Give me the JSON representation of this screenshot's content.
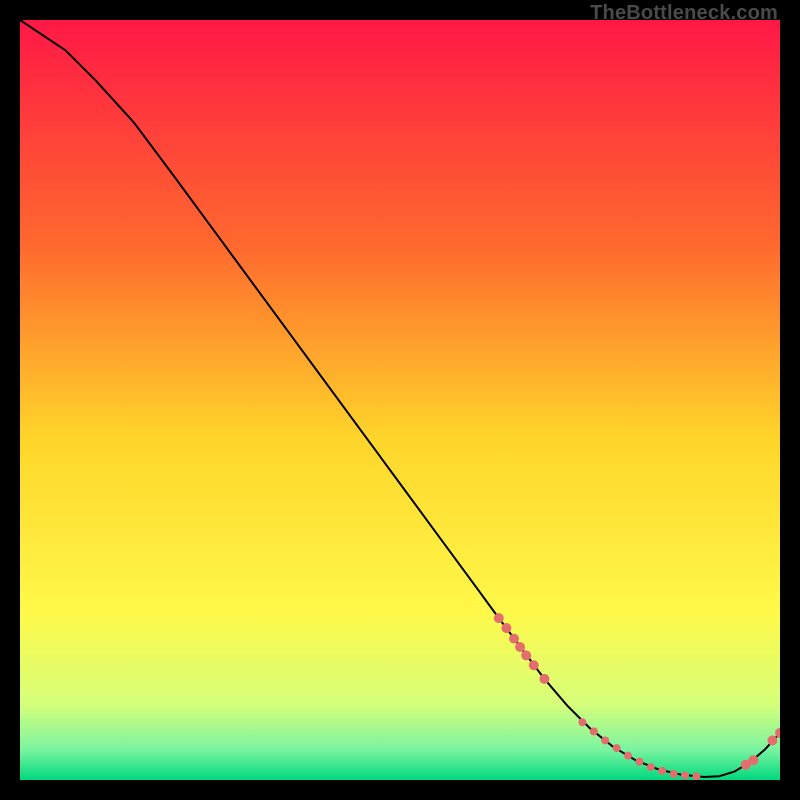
{
  "watermark": "TheBottleneck.com",
  "chart_data": {
    "type": "line",
    "title": "",
    "xlabel": "",
    "ylabel": "",
    "xlim": [
      0,
      100
    ],
    "ylim": [
      0,
      100
    ],
    "background_gradient": {
      "type": "vertical",
      "stops": [
        {
          "offset": 0.0,
          "color": "#ff1846"
        },
        {
          "offset": 0.3,
          "color": "#ff6a2e"
        },
        {
          "offset": 0.55,
          "color": "#ffd52a"
        },
        {
          "offset": 0.78,
          "color": "#fff94a"
        },
        {
          "offset": 0.9,
          "color": "#d6ff7a"
        },
        {
          "offset": 0.96,
          "color": "#7bf4a0"
        },
        {
          "offset": 1.0,
          "color": "#00d97e"
        }
      ]
    },
    "series": [
      {
        "name": "curve",
        "color": "#000000",
        "x": [
          0,
          6,
          10,
          15,
          20,
          25,
          30,
          35,
          40,
          45,
          50,
          55,
          60,
          63,
          66,
          69,
          72,
          75,
          78,
          81,
          84,
          87,
          90,
          92,
          94,
          96,
          98,
          100
        ],
        "y": [
          100,
          96,
          92,
          86.5,
          79.8,
          73,
          66.2,
          59.4,
          52.6,
          45.8,
          39,
          32.2,
          25.4,
          21.3,
          17.3,
          13.3,
          9.8,
          6.8,
          4.4,
          2.6,
          1.4,
          0.7,
          0.4,
          0.5,
          1.1,
          2.3,
          4.0,
          6.2
        ]
      }
    ],
    "markers": [
      {
        "name": "cluster-descent",
        "color": "#e46e6e",
        "radius": 5,
        "points": [
          {
            "x": 63.0,
            "y": 21.3
          },
          {
            "x": 64.0,
            "y": 20.0
          },
          {
            "x": 65.0,
            "y": 18.6
          },
          {
            "x": 65.8,
            "y": 17.5
          },
          {
            "x": 66.6,
            "y": 16.4
          },
          {
            "x": 67.6,
            "y": 15.1
          },
          {
            "x": 69.0,
            "y": 13.3
          }
        ]
      },
      {
        "name": "cluster-valley",
        "color": "#e46e6e",
        "radius": 4,
        "points": [
          {
            "x": 74.0,
            "y": 7.6
          },
          {
            "x": 75.5,
            "y": 6.4
          },
          {
            "x": 77.0,
            "y": 5.2
          },
          {
            "x": 78.5,
            "y": 4.2
          },
          {
            "x": 80.0,
            "y": 3.2
          },
          {
            "x": 81.5,
            "y": 2.4
          },
          {
            "x": 83.0,
            "y": 1.7
          },
          {
            "x": 84.5,
            "y": 1.2
          },
          {
            "x": 86.0,
            "y": 0.8
          },
          {
            "x": 87.5,
            "y": 0.6
          },
          {
            "x": 89.0,
            "y": 0.5
          }
        ]
      },
      {
        "name": "cluster-rise",
        "color": "#e46e6e",
        "radius": 5,
        "points": [
          {
            "x": 95.5,
            "y": 2.0
          },
          {
            "x": 96.5,
            "y": 2.6
          },
          {
            "x": 99.0,
            "y": 5.2
          },
          {
            "x": 100.0,
            "y": 6.2
          }
        ]
      }
    ]
  }
}
